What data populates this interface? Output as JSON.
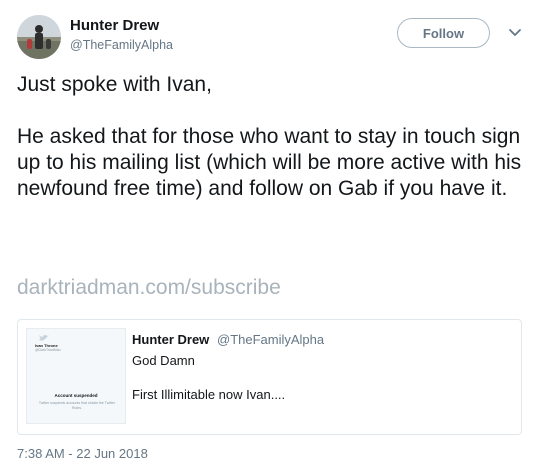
{
  "author": {
    "display_name": "Hunter Drew",
    "handle": "@TheFamilyAlpha"
  },
  "follow_label": "Follow",
  "tweet": {
    "line1": "Just spoke with Ivan,",
    "line2": "He asked that for those who want to stay in touch sign up to his mailing list (which will be more active with his newfound free time) and follow on Gab if you have it.",
    "link": "darktriadman.com/subscribe"
  },
  "quote": {
    "author_name": "Hunter Drew",
    "author_handle": "@TheFamilyAlpha",
    "line1": "God Damn",
    "line2": "First Illimitable now Ivan....",
    "media": {
      "profile_name": "Ivan Throne",
      "profile_handle": "@DarkTriadMan",
      "status": "Account suspended",
      "note": "Twitter suspends accounts that violate the Twitter Rules."
    }
  },
  "timestamp": "7:38 AM - 22 Jun 2018",
  "colors": {
    "text": "#14171a",
    "secondary": "#657786",
    "link": "#a9b3bc",
    "border": "#e1e8ed"
  }
}
